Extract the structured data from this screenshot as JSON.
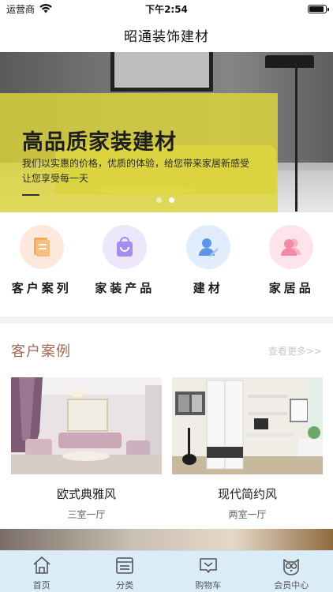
{
  "status_bar": {
    "carrier": "运营商",
    "time": "下午2:54",
    "battery_level": 0.9
  },
  "nav": {
    "title": "昭通装饰建材"
  },
  "banner": {
    "headline": "高品质家装建材",
    "subtitle_line1": "我们以实惠的价格，优质的体验，给您带来家居新感受",
    "subtitle_line2": "让您享受每一天",
    "page_count": 2,
    "active_page": 2,
    "overlay_color": "#ded63a"
  },
  "categories": [
    {
      "label": "客户案列",
      "icon": "book-icon",
      "bg": "#fde9dc",
      "color": "#f7a85c"
    },
    {
      "label": "家装产品",
      "icon": "shopping-bag-icon",
      "bg": "#ece7fb",
      "color": "#a58df0"
    },
    {
      "label": "建材",
      "icon": "user-edit-icon",
      "bg": "#e2edfb",
      "color": "#5a95e8"
    },
    {
      "label": "家居品",
      "icon": "users-icon",
      "bg": "#fde3ec",
      "color": "#f08aa6"
    }
  ],
  "section": {
    "title": "客户案例",
    "more_link": "查看更多>>",
    "title_color": "#a06a55"
  },
  "cases": [
    {
      "title": "欧式典雅风",
      "subtitle": "三室一厅"
    },
    {
      "title": "现代简约风",
      "subtitle": "两室一厅"
    }
  ],
  "tabbar": {
    "background": "#d9ecf7",
    "items": [
      {
        "label": "首页",
        "icon": "home-icon"
      },
      {
        "label": "分类",
        "icon": "list-icon"
      },
      {
        "label": "购物车",
        "icon": "cart-icon"
      },
      {
        "label": "会员中心",
        "icon": "owl-icon"
      }
    ]
  }
}
